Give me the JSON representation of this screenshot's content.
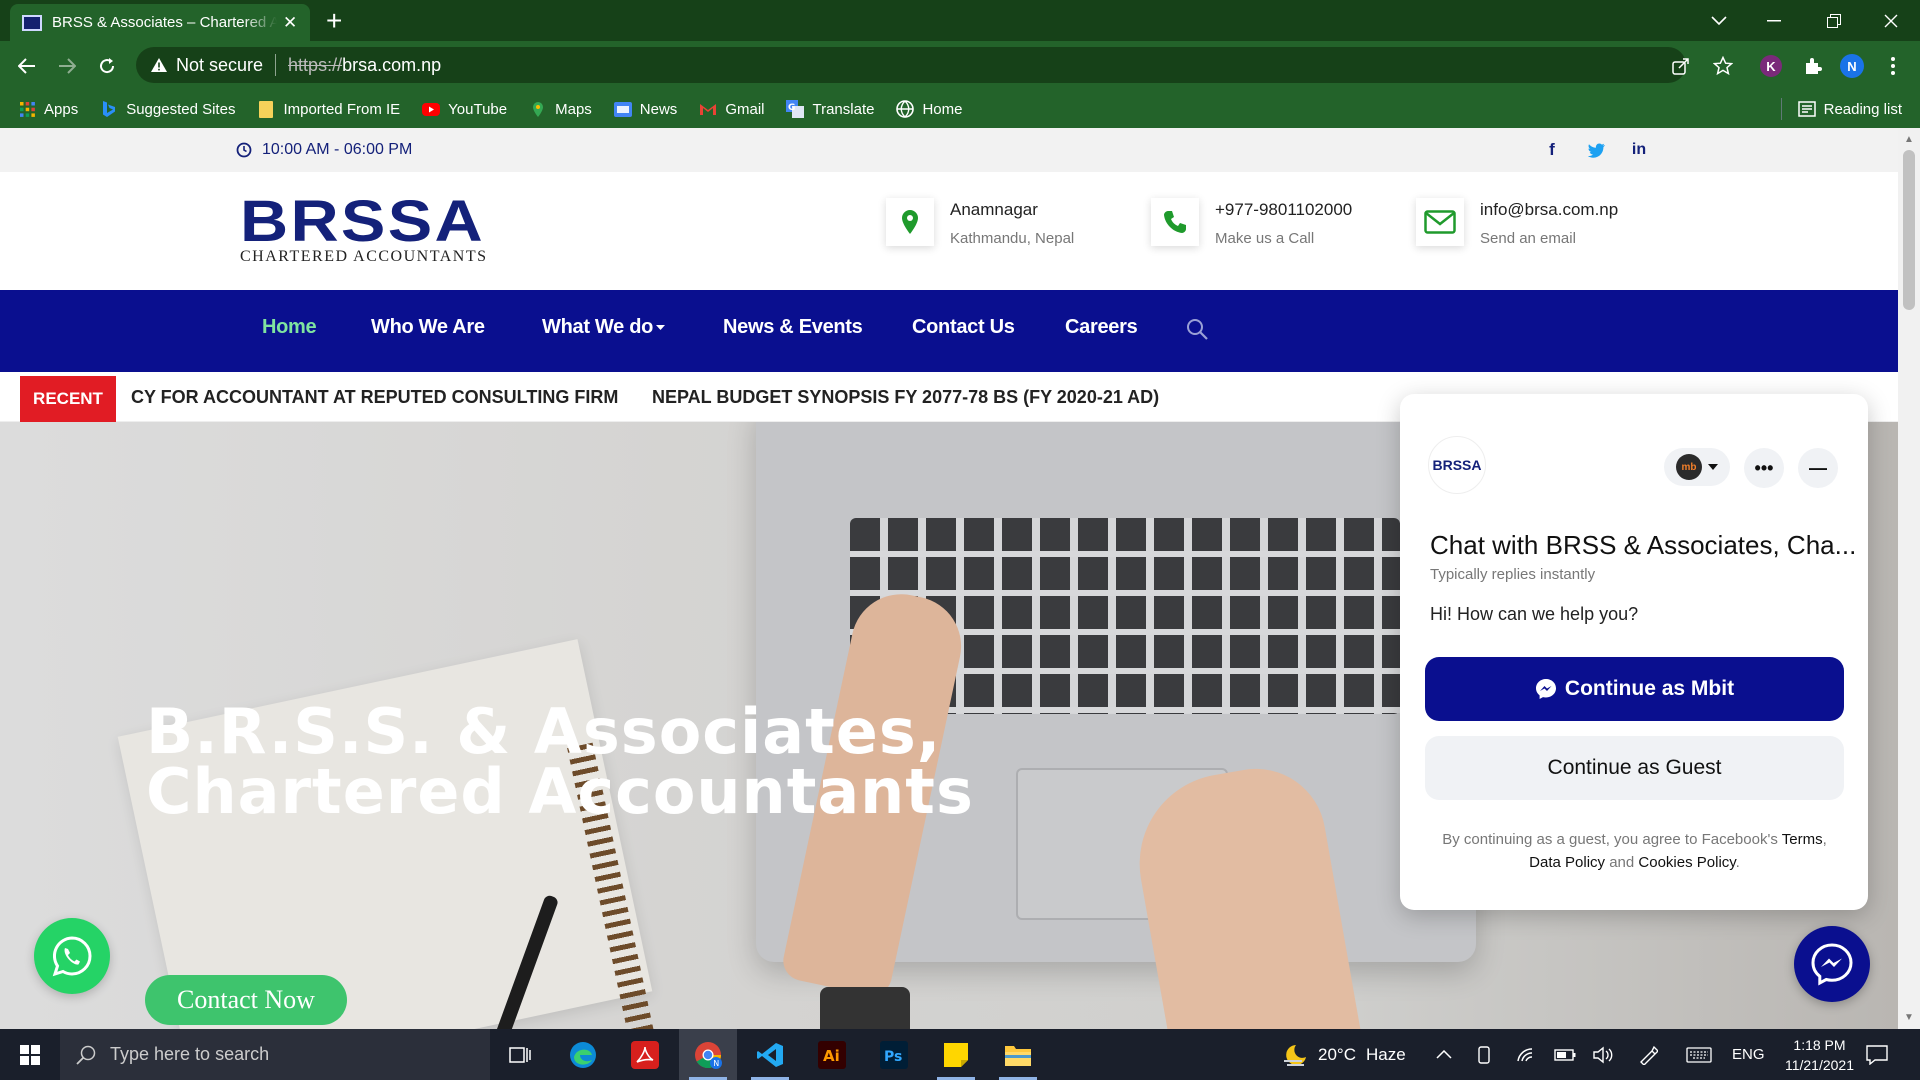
{
  "browser": {
    "tab_title": "BRSS & Associates – Chartered Accountants",
    "tab_close": "✕",
    "new_tab": "+",
    "security_label": "Not secure",
    "url_scheme": "https://",
    "url_host": "brsa.com.np",
    "profile_initial_k": "K",
    "profile_initial_n": "N",
    "bookmarks": [
      {
        "label": "Apps",
        "icon": "apps-grid-icon"
      },
      {
        "label": "Suggested Sites",
        "icon": "bing-icon"
      },
      {
        "label": "Imported From IE",
        "icon": "folder-icon"
      },
      {
        "label": "YouTube",
        "icon": "youtube-icon"
      },
      {
        "label": "Maps",
        "icon": "maps-icon"
      },
      {
        "label": "News",
        "icon": "google-news-icon"
      },
      {
        "label": "Gmail",
        "icon": "gmail-icon"
      },
      {
        "label": "Translate",
        "icon": "translate-icon"
      },
      {
        "label": "Home",
        "icon": "globe-icon"
      }
    ],
    "reading_list": "Reading list"
  },
  "site": {
    "hours": "10:00 AM - 06:00 PM",
    "logo_main": "BRSSA",
    "logo_sub": "CHARTERED ACCOUNTANTS",
    "contact": [
      {
        "title": "Anamnagar",
        "sub": "Kathmandu, Nepal",
        "icon": "map-pin-icon"
      },
      {
        "title": "+977-9801102000",
        "sub": "Make us a Call",
        "icon": "phone-icon"
      },
      {
        "title": "info@brsa.com.np",
        "sub": "Send an email",
        "icon": "envelope-icon"
      }
    ],
    "nav": [
      "Home",
      "Who We Are",
      "What We do",
      "News & Events",
      "Contact Us",
      "Careers"
    ],
    "recent_label": "RECENT",
    "ticker": [
      "CY FOR ACCOUNTANT AT REPUTED CONSULTING FIRM",
      "NEPAL BUDGET SYNOPSIS FY 2077-78 BS (FY 2020-21 AD)"
    ],
    "hero_line1": "B.R.S.S. & Associates,",
    "hero_line2": "Chartered Accountants",
    "cta": "Contact Now"
  },
  "chat": {
    "logo": "BRSSA",
    "account_badge": "mb",
    "more": "•••",
    "minimize": "—",
    "title": "Chat with BRSS & Associates, Cha...",
    "subtitle": "Typically replies instantly",
    "greeting": "Hi! How can we help you?",
    "primary_button": "Continue as Mbit",
    "secondary_button": "Continue as Guest",
    "legal_prefix": "By continuing as a guest, you agree to Facebook's",
    "legal_terms": "Terms",
    "legal_data": "Data Policy",
    "legal_and": "and",
    "legal_cookies": "Cookies Policy"
  },
  "taskbar": {
    "search_placeholder": "Type here to search",
    "weather_temp": "20°C",
    "weather_desc": "Haze",
    "lang": "ENG",
    "time": "1:18 PM",
    "date": "11/21/2021",
    "apps": [
      "task-view-icon",
      "edge-icon",
      "acrobat-icon",
      "chrome-icon",
      "vscode-icon",
      "illustrator-icon",
      "photoshop-icon",
      "sticky-notes-icon",
      "file-explorer-icon"
    ]
  },
  "colors": {
    "brand_navy": "#0a0f8f",
    "accent_green": "#3ec46d",
    "recent_red": "#e11c24",
    "chrome_green": "#23632a"
  }
}
